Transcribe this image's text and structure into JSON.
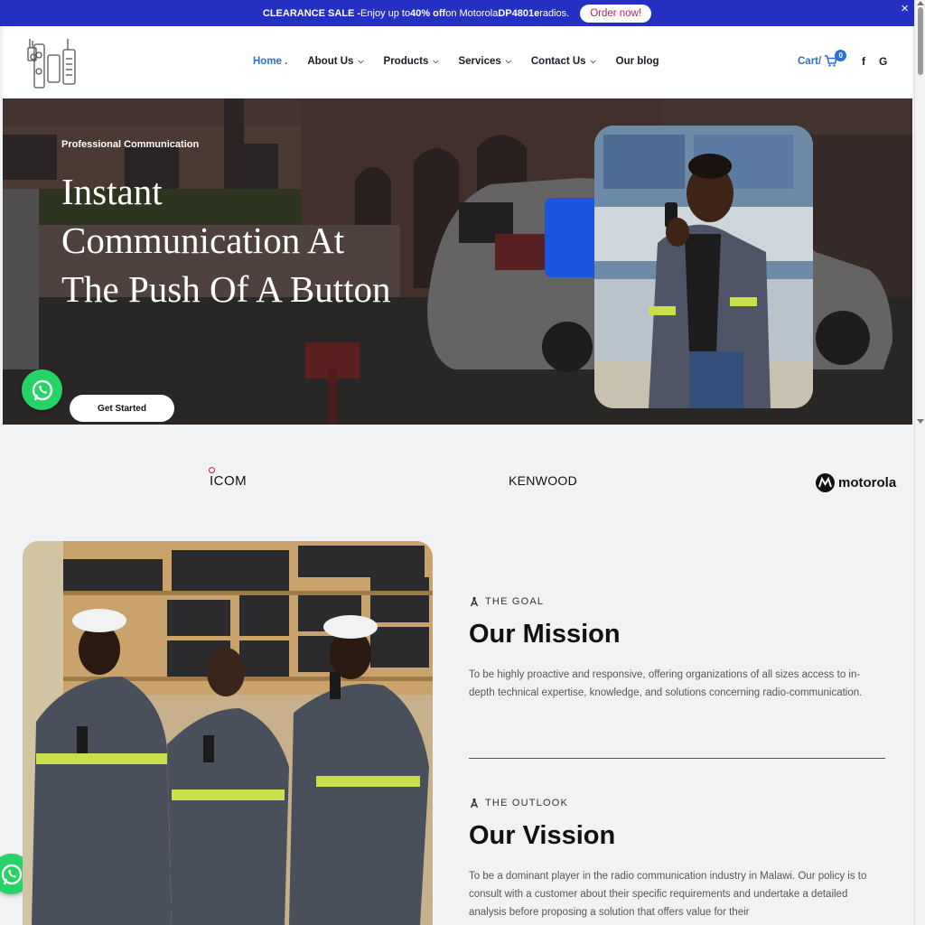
{
  "promo": {
    "prefix": "CLEARANCE SALE - ",
    "text1": "Enjoy up to ",
    "percent": "40% off",
    "text2": " on Motorola ",
    "model": "DP4801e",
    "text3": " radios.",
    "order_label": "Order now!",
    "close_glyph": "×"
  },
  "nav": {
    "items": [
      {
        "label": "Home .",
        "dropdown": false,
        "active": true
      },
      {
        "label": "About Us",
        "dropdown": true
      },
      {
        "label": "Products",
        "dropdown": true
      },
      {
        "label": "Services",
        "dropdown": true
      },
      {
        "label": "Contact Us",
        "dropdown": true
      },
      {
        "label": "Our blog",
        "dropdown": false
      }
    ],
    "chevron": "⌄",
    "cart_label": "Cart/",
    "cart_count": "0",
    "facebook": "f",
    "google": "G"
  },
  "hero": {
    "kicker": "Professional Communication",
    "title": "Instant Communication At The Push Of A Button",
    "cta_label": "Get Started"
  },
  "brands": {
    "icom": "ICOM",
    "kenwood": "KENWOOD",
    "motorola": "motorola"
  },
  "mission": {
    "tag": "THE GOAL",
    "title": "Our Mission",
    "body": "To be highly proactive and responsive, offering organizations of all sizes access to in-depth technical expertise, knowledge, and solutions concerning radio-communication."
  },
  "vision": {
    "tag": "THE OUTLOOK",
    "title": "Our Vission",
    "body": "To be a dominant player in the radio communication industry in Malawi. Our policy is to consult with a customer about their specific requirements and undertake a detailed analysis before proposing a solution that offers value for their"
  },
  "colors": {
    "promo_bg": "#2430c2",
    "accent": "#2a6fd6",
    "whatsapp": "#25d366"
  }
}
